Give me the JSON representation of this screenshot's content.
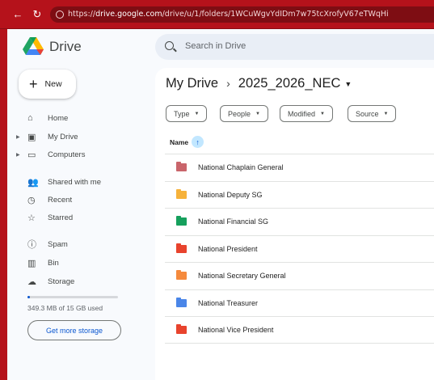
{
  "browser": {
    "url_prefix": "https://",
    "url_host": "drive.google.com",
    "url_path": "/drive/u/1/folders/1WCuWgvYdIDm7w75tcXrofyV67eTWqHi"
  },
  "app": {
    "name": "Drive",
    "search_placeholder": "Search in Drive",
    "new_button": "New"
  },
  "sidebar": {
    "items": [
      {
        "label": "Home",
        "icon": "home-icon",
        "glyph": "⌂"
      },
      {
        "label": "My Drive",
        "icon": "my-drive-icon",
        "glyph": "▣"
      },
      {
        "label": "Computers",
        "icon": "computers-icon",
        "glyph": "▭"
      },
      {
        "label": "Shared with me",
        "icon": "shared-icon",
        "glyph": "👥"
      },
      {
        "label": "Recent",
        "icon": "recent-icon",
        "glyph": "◷"
      },
      {
        "label": "Starred",
        "icon": "star-icon",
        "glyph": "☆"
      },
      {
        "label": "Spam",
        "icon": "spam-icon",
        "glyph": "ⓘ"
      },
      {
        "label": "Bin",
        "icon": "bin-icon",
        "glyph": "▥"
      },
      {
        "label": "Storage",
        "icon": "cloud-icon",
        "glyph": "☁"
      }
    ],
    "storage_used_fraction": 0.023,
    "storage_text": "349.3 MB of 15 GB used",
    "more_storage": "Get more storage"
  },
  "breadcrumb": {
    "root": "My Drive",
    "current": "2025_2026_NEC"
  },
  "filters": [
    "Type",
    "People",
    "Modified",
    "Source"
  ],
  "table": {
    "column_name": "Name",
    "folders": [
      {
        "name": "National Chaplain General",
        "color": "#c9656b"
      },
      {
        "name": "National Deputy SG",
        "color": "#f6b23b"
      },
      {
        "name": "National Financial SG",
        "color": "#16a05d"
      },
      {
        "name": "National President",
        "color": "#e8432d"
      },
      {
        "name": "National Secretary General",
        "color": "#f58a3d"
      },
      {
        "name": "National Treasurer",
        "color": "#4a86e8"
      },
      {
        "name": "National Vice President",
        "color": "#e8432d"
      }
    ]
  }
}
